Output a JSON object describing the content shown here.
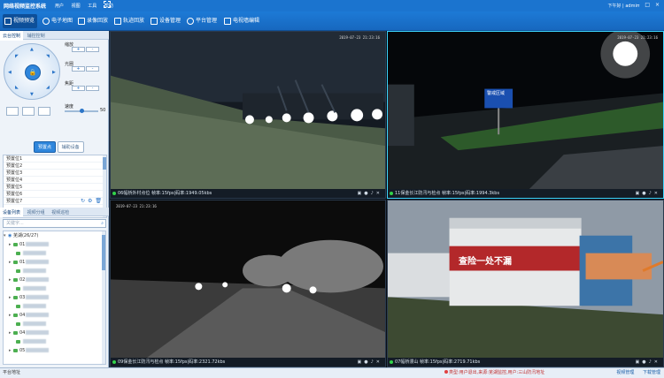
{
  "title_bar": {
    "app_title": "网络视频监控系统",
    "menus": [
      "用户",
      "视图",
      "工具",
      "帮助"
    ],
    "user": "下午好 | admin",
    "window_buttons": [
      "–",
      "□",
      "×"
    ]
  },
  "toolbar": {
    "items": [
      {
        "label": "视频预览",
        "icon": "monitor-icon",
        "active": true
      },
      {
        "label": "电子地图",
        "icon": "map-pin-icon",
        "active": false
      },
      {
        "label": "录像回放",
        "icon": "playback-icon",
        "active": false
      },
      {
        "label": "轨迹回放",
        "icon": "track-icon",
        "active": false
      },
      {
        "label": "设备管理",
        "icon": "device-icon",
        "active": false
      },
      {
        "label": "平台管理",
        "icon": "platform-icon",
        "active": false
      },
      {
        "label": "电视墙编辑",
        "icon": "tv-wall-icon",
        "active": false
      }
    ]
  },
  "ptz_panel": {
    "tabs": [
      "云台控制",
      "辅控控制"
    ],
    "controls": [
      {
        "label": "缩放",
        "minus": "-",
        "plus": "+"
      },
      {
        "label": "光圈",
        "minus": "-",
        "plus": "+"
      },
      {
        "label": "焦距",
        "minus": "-",
        "plus": "+"
      }
    ],
    "speed_label": "速度",
    "speed_value": "50",
    "speed_fraction": 0.5,
    "mode_tabs": [
      "预置点",
      "辅助设备"
    ],
    "presets": [
      "预置位1",
      "预置位2",
      "预置位3",
      "预置位4",
      "预置位5",
      "预置位6",
      "预置位7"
    ]
  },
  "device_panel": {
    "tabs": [
      "设备列表",
      "视频分组",
      "视频巡检"
    ],
    "search_placeholder": "关键字...",
    "tree": [
      {
        "label": "芜湖(26/27)",
        "level": 0,
        "type": "folder"
      },
      {
        "label": "01",
        "level": 1,
        "type": "camera"
      },
      {
        "label": "",
        "level": 2,
        "type": "camera"
      },
      {
        "label": "01",
        "level": 1,
        "type": "camera"
      },
      {
        "label": "",
        "level": 2,
        "type": "camera"
      },
      {
        "label": "02",
        "level": 1,
        "type": "camera"
      },
      {
        "label": "",
        "level": 2,
        "type": "camera"
      },
      {
        "label": "03",
        "level": 1,
        "type": "camera"
      },
      {
        "label": "",
        "level": 2,
        "type": "camera"
      },
      {
        "label": "04",
        "level": 1,
        "type": "camera"
      },
      {
        "label": "",
        "level": 2,
        "type": "camera"
      },
      {
        "label": "04",
        "level": 1,
        "type": "camera"
      },
      {
        "label": "",
        "level": 2,
        "type": "camera"
      },
      {
        "label": "05",
        "level": 1,
        "type": "camera"
      }
    ]
  },
  "videos": [
    {
      "status": "06幅桥外村点位 帧率:15fps|码率:1949.05kbs",
      "osd_time": "2019-07-23 21:23:16"
    },
    {
      "status": "11保金长江防汛与检点 帧率:15fps|码率:1994.3kbs",
      "osd_time": "2019-07-23 21:23:16",
      "sign": "警戒区域"
    },
    {
      "status": "09保金长江防汛与检点 帧率:15fps|码率:2321.72kbs",
      "osd_time": "2019-07-23 21:23:16"
    },
    {
      "status": "07幅桥漫山 帧率:15fps|码率:2719.71kbs",
      "osd_time": "",
      "banner": "查险一处不漏"
    }
  ],
  "status_bar": {
    "left": "平台地址",
    "message": "类型:用户退出,来源:芜湖监控,用户:三山防汛地址",
    "buttons": [
      "视频管理",
      "下载管理"
    ]
  }
}
